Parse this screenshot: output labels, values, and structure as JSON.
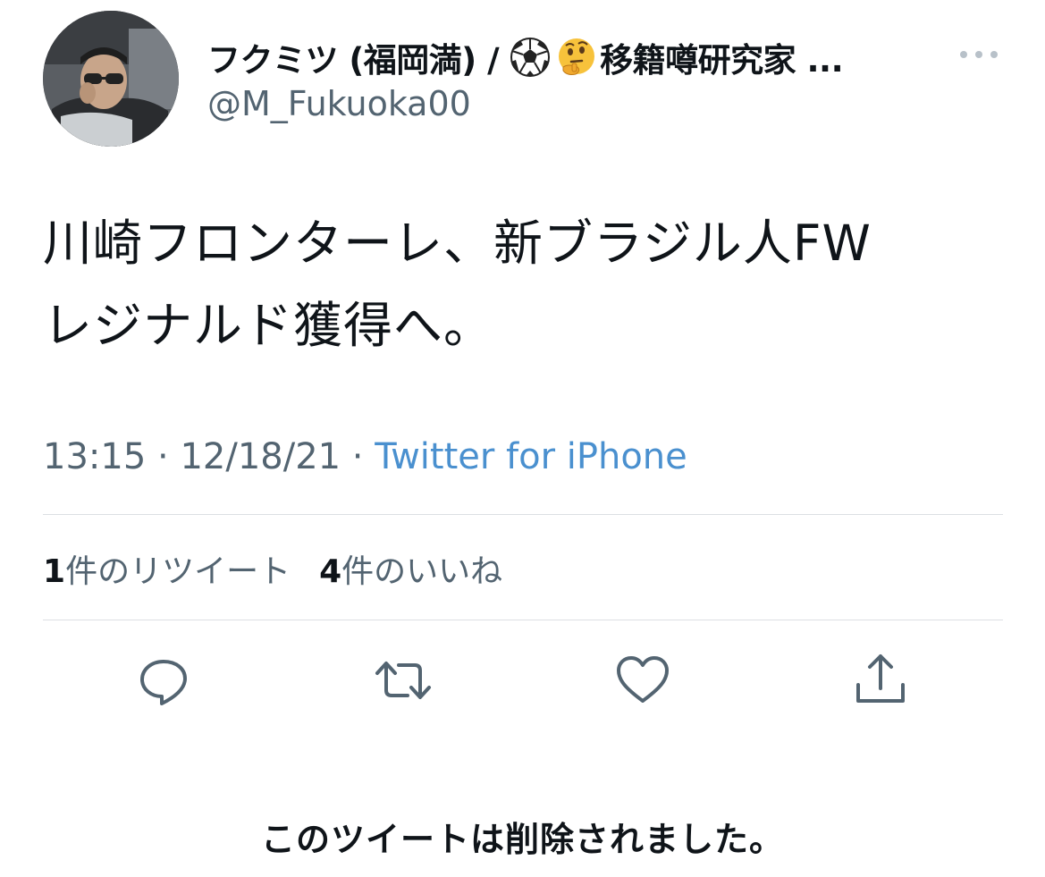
{
  "author": {
    "display_name_prefix": "フクミツ (福岡満) /",
    "emoji_1": "soccer-ball-icon",
    "emoji_2": "thinking-face-icon",
    "display_name_suffix": "移籍噂研究家 ...",
    "handle": "@M_Fukuoka00"
  },
  "tweet": {
    "line1": "川崎フロンターレ、新ブラジル人FW",
    "line2": "レジナルド獲得へ。"
  },
  "meta": {
    "time": "13:15",
    "separator": " · ",
    "date": "12/18/21",
    "source": "Twitter for iPhone"
  },
  "stats": {
    "retweets_count": "1",
    "retweets_label": "件のリツイート",
    "likes_count": "4",
    "likes_label": "件のいいね"
  },
  "actions": [
    "reply-icon",
    "retweet-icon",
    "like-icon",
    "share-icon"
  ],
  "notice": "このツイートは削除されました。",
  "colors": {
    "text": "#0f1419",
    "secondary": "#536471",
    "link": "#4a90cf",
    "divider": "#dcdfe3"
  }
}
